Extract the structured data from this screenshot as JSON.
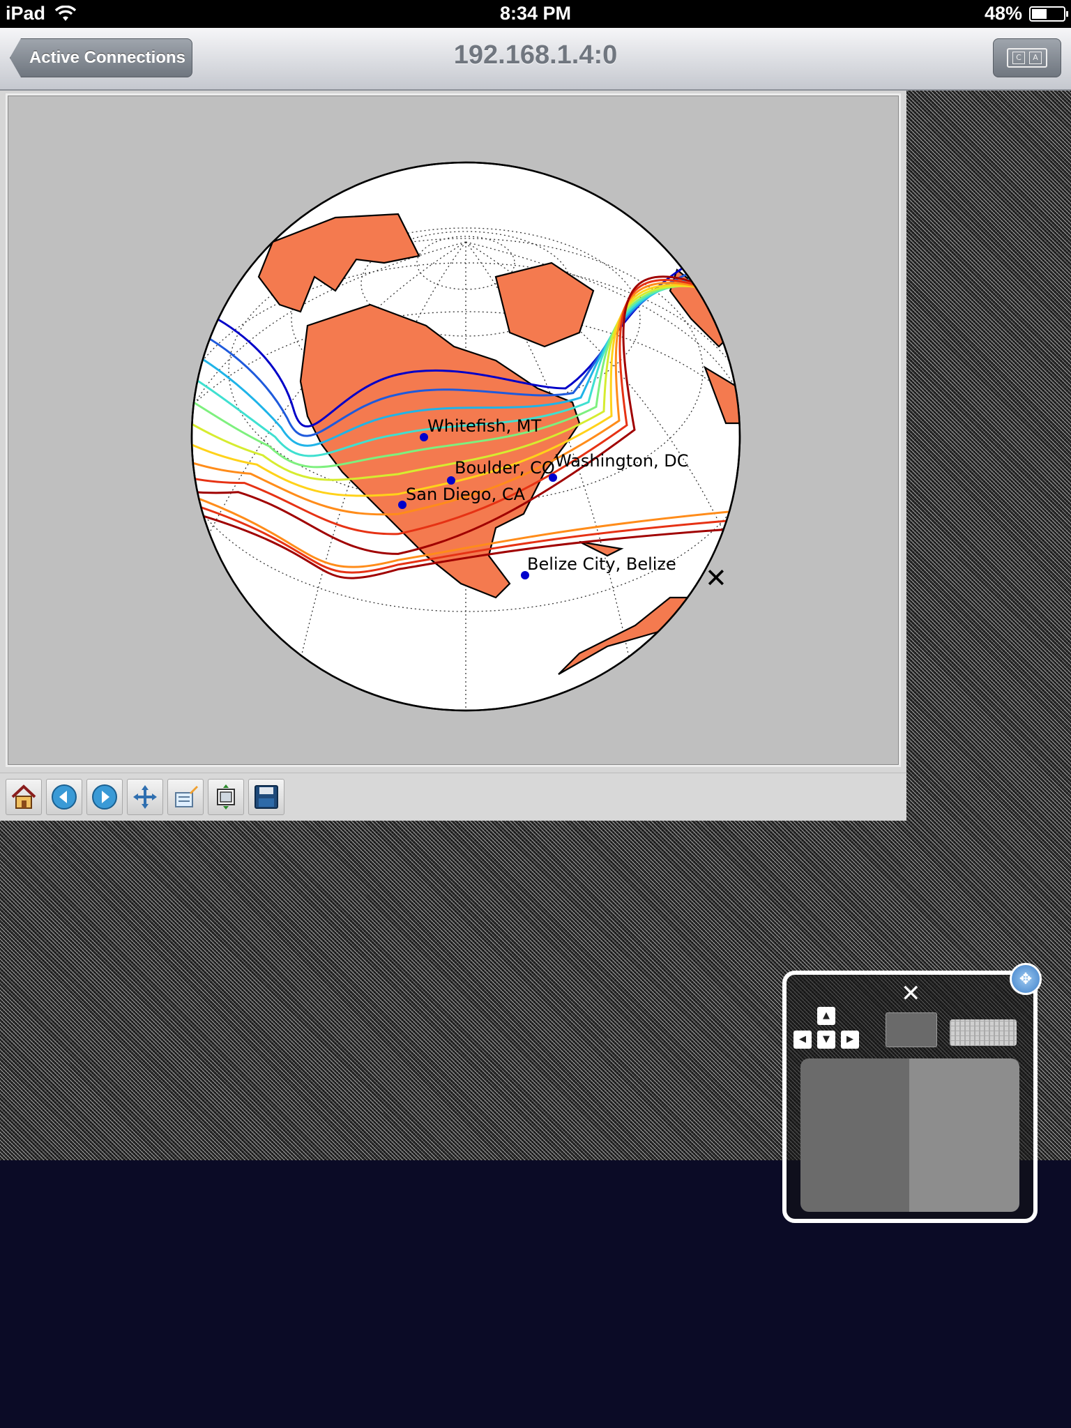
{
  "statusbar": {
    "device": "iPad",
    "time": "8:34 PM",
    "battery": "48%",
    "battery_level": 0.48
  },
  "navbar": {
    "back_label": "Active Connections",
    "title": "192.168.1.4:0",
    "kbd_keys": [
      "C",
      "A"
    ]
  },
  "figure": {
    "cities": [
      {
        "label": "Whitefish, MT"
      },
      {
        "label": "Boulder, CO"
      },
      {
        "label": "Washington, DC"
      },
      {
        "label": "San Diego, CA"
      },
      {
        "label": "Belize City, Belize"
      }
    ],
    "colors": {
      "land": "#f47a4f",
      "background": "#bfbfbf",
      "ocean": "#ffffff",
      "city_marker": "#0000cc"
    },
    "contour_colors": [
      "#0000c8",
      "#1e5adc",
      "#1fb4e8",
      "#3fe0d0",
      "#7ef07e",
      "#d6ec30",
      "#ffd21a",
      "#ff8c1a",
      "#e63214",
      "#a00000"
    ]
  },
  "toolbar": {
    "buttons": [
      "home-icon",
      "back-arrow-icon",
      "forward-arrow-icon",
      "pan-icon",
      "configure-subplots-icon",
      "zoom-rect-icon",
      "save-icon"
    ]
  },
  "controls": {
    "close_glyph": "✕",
    "arrows": [
      "▲",
      "◀",
      "▼",
      "▶"
    ]
  }
}
